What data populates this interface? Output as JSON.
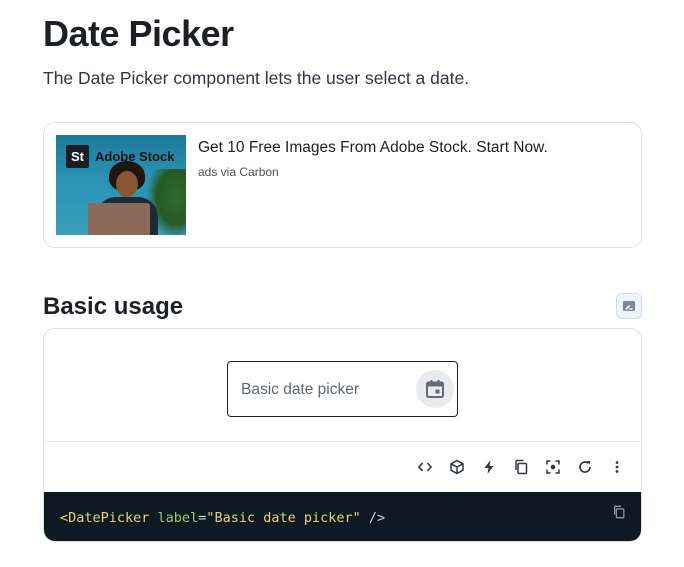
{
  "header": {
    "title": "Date Picker",
    "description": "The Date Picker component lets the user select a date."
  },
  "ad": {
    "logo_mark": "St",
    "logo_text": "Adobe Stock",
    "title": "Get 10 Free Images From Adobe Stock. Start Now.",
    "sub": "ads via Carbon"
  },
  "section": {
    "title": "Basic usage",
    "edit_icon": "edit-in-sandbox-icon"
  },
  "demo": {
    "input_placeholder": "Basic date picker",
    "calendar_icon": "calendar-icon"
  },
  "toolbar": {
    "icons": [
      "code-icon",
      "codesandbox-icon",
      "stackblitz-icon",
      "copy-icon",
      "focus-icon",
      "reset-icon",
      "more-icon"
    ]
  },
  "code": {
    "tag_open": "<DatePicker",
    "attr": "label",
    "eq": "=",
    "value": "\"Basic date picker\"",
    "tag_close": " />"
  },
  "colors": {
    "text": "#1c2025",
    "border": "#dae2ed",
    "code_bg": "#0f1923",
    "code_tag": "#e6d271",
    "code_attr": "#9ccc65"
  }
}
